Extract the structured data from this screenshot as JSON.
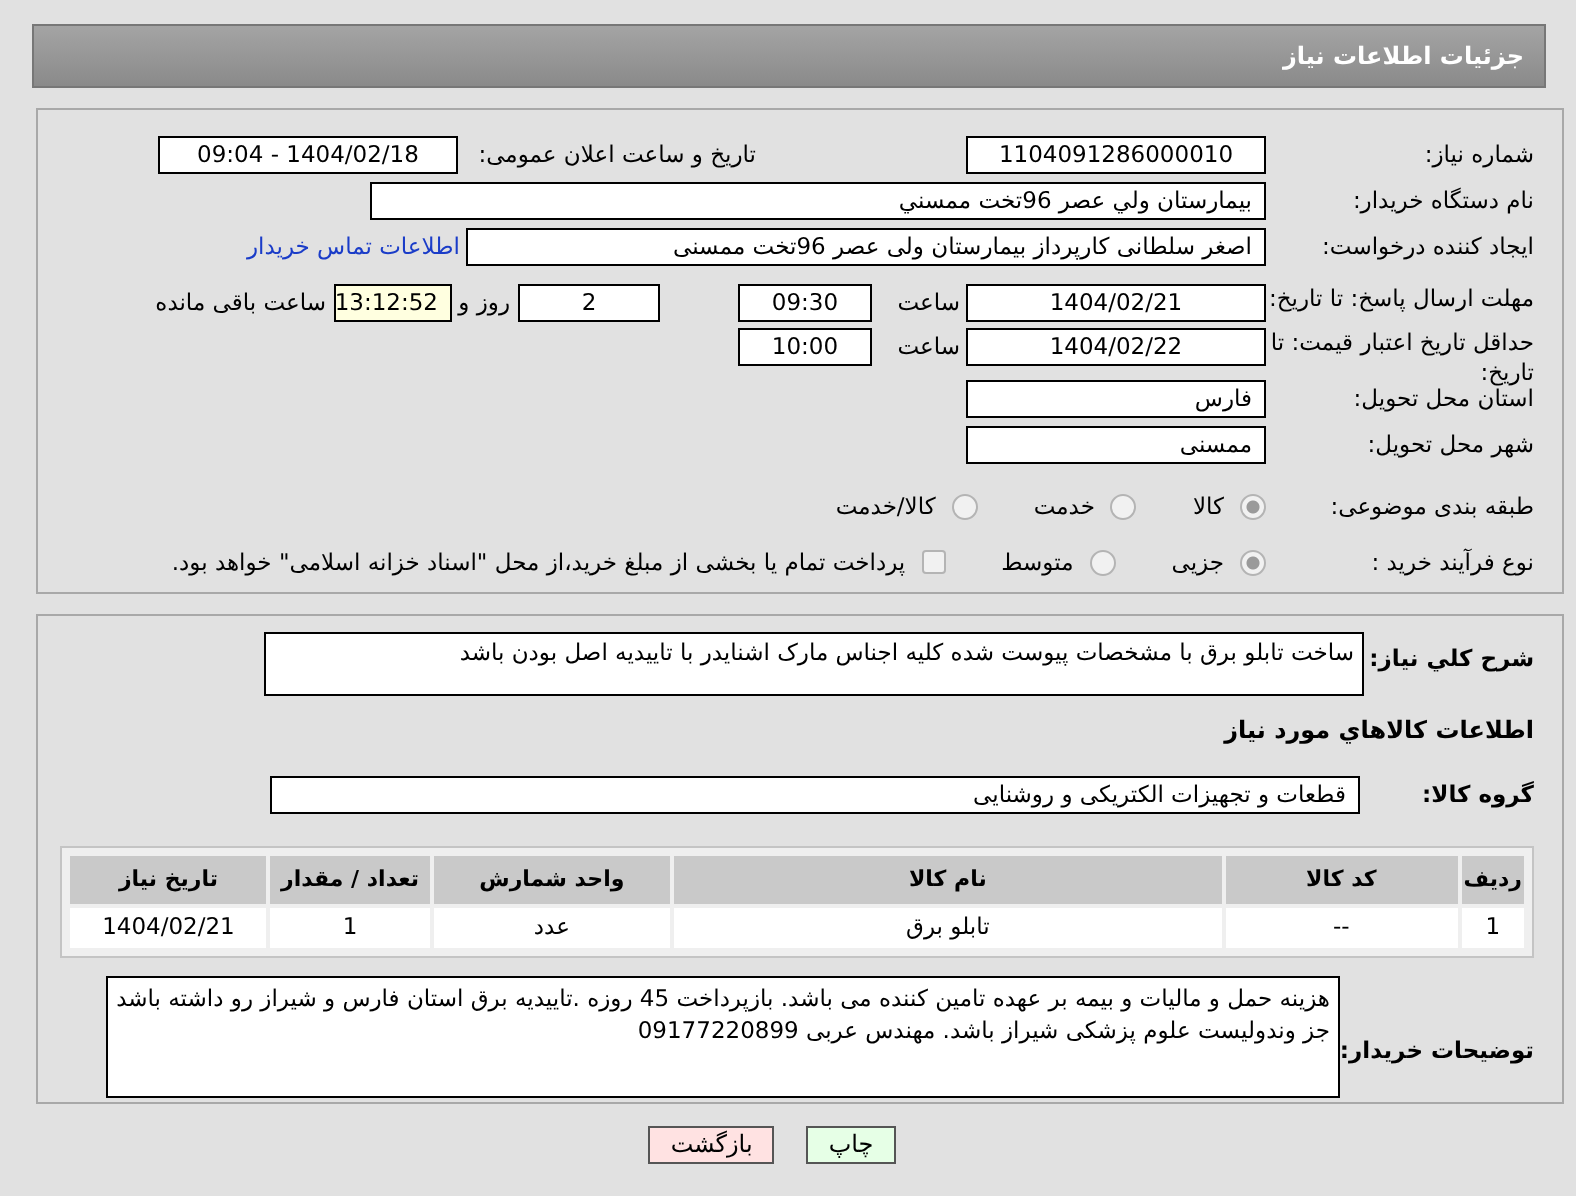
{
  "header": {
    "title": "جزئیات اطلاعات نیاز"
  },
  "need_number": {
    "label": "شماره نیاز:",
    "value": "1104091286000010"
  },
  "announce": {
    "label": "تاریخ و ساعت اعلان عمومی:",
    "value": "1404/02/18 - 09:04"
  },
  "buyer_org": {
    "label": "نام دستگاه خریدار:",
    "value": "بیمارستان ولي عصر  96تخت ممسني"
  },
  "requester": {
    "label": "ایجاد کننده درخواست:",
    "value": "اصغر سلطانی کارپرداز بیمارستان ولی عصر  96تخت ممسنی",
    "link": "اطلاعات تماس خریدار"
  },
  "response_deadline": {
    "label": "مهلت ارسال پاسخ: تا تاریخ:",
    "date": "1404/02/21",
    "time_label": "ساعت",
    "time": "09:30",
    "days": "2",
    "days_label": "روز و",
    "remaining": "13:12:52",
    "remaining_label": "ساعت باقی مانده"
  },
  "price_validity": {
    "label": "حداقل تاریخ اعتبار قیمت: تا تاریخ:",
    "date": "1404/02/22",
    "time_label": "ساعت",
    "time": "10:00"
  },
  "province": {
    "label": "استان محل تحویل:",
    "value": "فارس"
  },
  "city": {
    "label": "شهر محل تحویل:",
    "value": "ممسنی"
  },
  "category": {
    "label": "طبقه بندی موضوعی:",
    "options": [
      {
        "label": "کالا",
        "selected": true
      },
      {
        "label": "خدمت",
        "selected": false
      },
      {
        "label": "کالا/خدمت",
        "selected": false
      }
    ]
  },
  "purchase_type": {
    "label": "نوع فرآیند خرید :",
    "options": [
      {
        "label": "جزیی",
        "selected": true
      },
      {
        "label": "متوسط",
        "selected": false
      }
    ],
    "payment": {
      "label": "پرداخت تمام یا بخشی از مبلغ خرید،از محل \"اسناد خزانه اسلامی\" خواهد بود.",
      "checked": false
    }
  },
  "description": {
    "label": "شرح کلي نياز:",
    "value": "ساخت تابلو برق با مشخصات پیوست شده  کلیه اجناس مارک اشنایدر با تاییدیه اصل بودن باشد"
  },
  "goods_title": "اطلاعات کالاهاي مورد نياز",
  "goods_group": {
    "label": "گروه کالا:",
    "value": "قطعات و تجهیزات الکتریکی و روشنایی"
  },
  "table": {
    "columns": [
      "ردیف",
      "کد کالا",
      "نام کالا",
      "واحد شمارش",
      "تعداد / مقدار",
      "تاریخ نیاز"
    ],
    "rows": [
      [
        "1",
        "--",
        "تابلو برق",
        "عدد",
        "1",
        "1404/02/21"
      ]
    ]
  },
  "buyer_notes": {
    "label": "توضیحات خریدار:",
    "value": "هزینه حمل و مالیات و بیمه بر عهده تامین کننده می باشد. بازپرداخت 45 روزه .تاییدیه برق استان فارس و شیراز رو داشته باشد جز وندولیست علوم پزشکی شیراز باشد. مهندس عربی 09177220899"
  },
  "buttons": [
    {
      "label": "چاپ",
      "kind": "print"
    },
    {
      "label": "بازگشت",
      "kind": "back"
    }
  ]
}
